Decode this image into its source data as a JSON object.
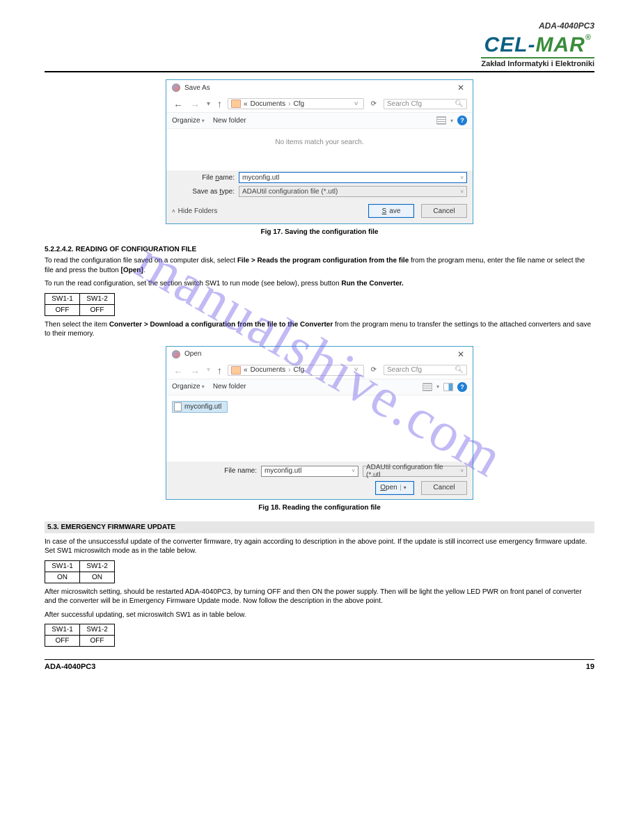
{
  "header": {
    "doc_title": "ADA-4040PC3",
    "logo_cel": "CEL",
    "logo_dash": "-",
    "logo_mar": "MAR",
    "logo_reg": "®",
    "logo_sub": "Zakład Informatyki i Elektroniki"
  },
  "watermark": "manualshive.com",
  "saveas": {
    "title": "Save As",
    "breadcrumb_prefix": "«",
    "bc1": "Documents",
    "bc2": "Cfg",
    "search_placeholder": "Search Cfg",
    "organize": "Organize",
    "newfolder": "New folder",
    "empty_msg": "No items match your search.",
    "filename_label_pre": "File ",
    "filename_label_u": "n",
    "filename_label_post": "ame:",
    "filename_value": "myconfig.utl",
    "saveas_label_pre": "Save as ",
    "saveas_label_u": "t",
    "saveas_label_post": "ype:",
    "saveas_value": "ADAUtil configuration file (*.utl)",
    "hide_folders": "Hide Folders",
    "save_u": "S",
    "save_post": "ave",
    "cancel": "Cancel"
  },
  "open": {
    "title": "Open",
    "breadcrumb_prefix": "«",
    "bc1": "Documents",
    "bc2": "Cfg",
    "search_placeholder": "Search Cfg",
    "organize": "Organize",
    "newfolder": "New folder",
    "file_item": "myconfig.utl",
    "filename_label_pre": "File ",
    "filename_label_u": "n",
    "filename_label_post": "ame:",
    "filename_value": "myconfig.utl",
    "filter_value": "ADAUtil configuration file (*.utl",
    "open_u": "O",
    "open_post": "pen",
    "cancel": "Cancel"
  },
  "captions": {
    "fig1": "Fig 17. Saving the configuration file",
    "fig2": "Fig 18. Reading the configuration file"
  },
  "sections": {
    "s1_no": "5.2.2.4.2. READING OF CONFIGURATION FILE",
    "s1_p1_a": "To read the configuration file saved on a computer disk, select ",
    "s1_p1_b": "File > Reads the program configuration from the file",
    "s1_p1_c": " from the program menu, enter the file name or select the file and press the button ",
    "s1_p1_d": "[Open]",
    "s1_p1_e": ".",
    "s1_p2_a": "To run the read configuration, set the section switch SW1 to run mode (see below), press button ",
    "s1_p2_b": "Run the Converter.",
    "sw_hd1": "SW1-1",
    "sw_hd2": "SW1-2",
    "sw_off": "OFF",
    "s1_p3_a": "Then select the item ",
    "s1_p3_b": "Converter > Download a configuration from the file to the Converter",
    "s1_p3_c": " from the program menu to transfer the settings to the attached converters and save to their memory.",
    "emerg_title": "5.3. EMERGENCY FIRMWARE UPDATE",
    "emerg_p1": "In case of the unsuccessful update of the converter firmware, try again according to description in the above point. If the update is still incorrect use emergency firmware update. Set SW1 microswitch mode as in the table below.",
    "emerg_p2_a": "After microswitch setting, should be restarted ADA-4040PC3, by turning OFF and then ON the power supply. Then will be light the yellow LED PWR on front panel of converter and the converter will be in Emergency Firmware Update mode. Now follow the description in the above point.",
    "emerg_p2_b": "After successful updating, set microswitch SW1 as in table below.",
    "sw_on": "ON"
  },
  "footer": {
    "label": "ADA-4040PC3",
    "page": "19"
  }
}
